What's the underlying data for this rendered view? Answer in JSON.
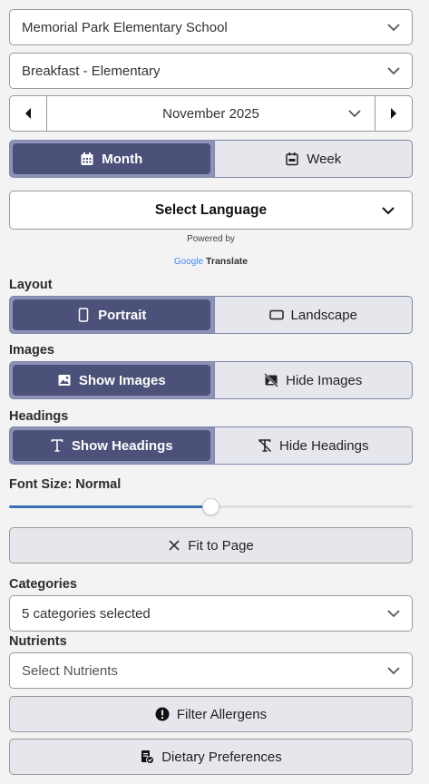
{
  "school_select": {
    "value": "Memorial Park Elementary School",
    "icon": "chevron-down-icon"
  },
  "menu_select": {
    "value": "Breakfast - Elementary",
    "icon": "chevron-down-icon"
  },
  "date_nav": {
    "month": "November 2025",
    "prev_icon": "caret-left-icon",
    "next_icon": "caret-right-icon"
  },
  "view_toggle": {
    "month_label": "Month",
    "week_label": "Week",
    "selected": "Month"
  },
  "language": {
    "label": "Select Language",
    "powered_by": "Powered by",
    "google": "Google",
    "translate": "Translate"
  },
  "layout": {
    "heading": "Layout",
    "portrait_label": "Portrait",
    "landscape_label": "Landscape",
    "selected": "Portrait"
  },
  "images": {
    "heading": "Images",
    "show_label": "Show Images",
    "hide_label": "Hide Images",
    "selected": "Show Images"
  },
  "headings": {
    "heading": "Headings",
    "show_label": "Show Headings",
    "hide_label": "Hide Headings",
    "selected": "Show Headings"
  },
  "font_size": {
    "label": "Font Size: Normal",
    "slider_fraction": 0.5
  },
  "fit_to_page": {
    "label": "Fit to Page"
  },
  "categories": {
    "heading": "Categories",
    "value": "5 categories selected"
  },
  "nutrients": {
    "heading": "Nutrients",
    "placeholder": "Select Nutrients"
  },
  "filter_allergens": {
    "label": "Filter Allergens"
  },
  "dietary_preferences": {
    "label": "Dietary Preferences"
  },
  "colors": {
    "accent_active": "#4b5179",
    "accent_border": "#8c92b8",
    "slider": "#3d6eb3"
  }
}
